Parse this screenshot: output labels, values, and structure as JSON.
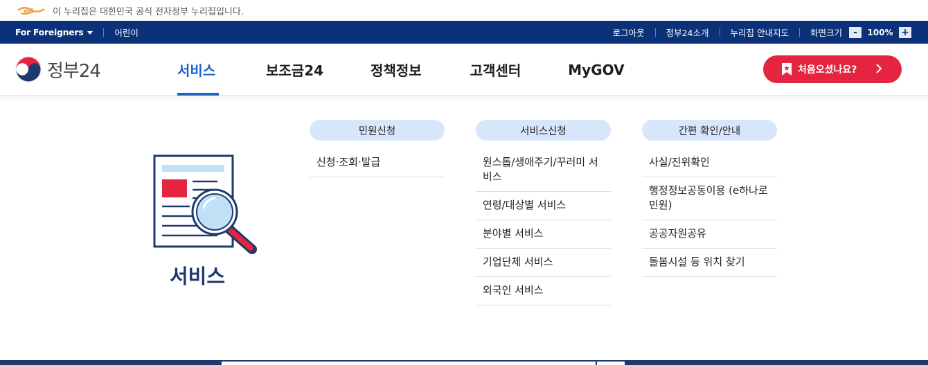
{
  "banner": {
    "text": "이 누리집은 대한민국 공식 전자정부 누리집입니다."
  },
  "util": {
    "lang": "For Foreigners",
    "kids": "어린이",
    "logout": "로그아웃",
    "about": "정부24소개",
    "sitemap": "누리집 안내지도",
    "zoom_label": "화면크기",
    "zoom_minus": "-",
    "zoom_value": "100%",
    "zoom_plus": "+"
  },
  "header": {
    "logo_text": "정부24",
    "nav": [
      "서비스",
      "보조금24",
      "정책정보",
      "고객센터",
      "MyGOV"
    ],
    "cta": "처음오셨나요?"
  },
  "mega": {
    "title": "서비스",
    "columns": [
      {
        "head": "민원신청",
        "items": [
          "신청·조회·발급"
        ]
      },
      {
        "head": "서비스신청",
        "items": [
          "원스톱/생애주기/꾸러미 서비스",
          "연령/대상별 서비스",
          "분야별 서비스",
          "기업단체 서비스",
          "외국인 서비스"
        ]
      },
      {
        "head": "간편 확인/안내",
        "items": [
          "사실/진위확인",
          "행정정보공동이용 (e하나로민원)",
          "공공자원공유",
          "돌봄시설 등 위치 찾기"
        ]
      }
    ]
  },
  "colors": {
    "navy": "#0b3278",
    "accent_blue": "#1a64c8",
    "cta_red": "#e5253f",
    "pill_blue": "#d8e6fb"
  }
}
